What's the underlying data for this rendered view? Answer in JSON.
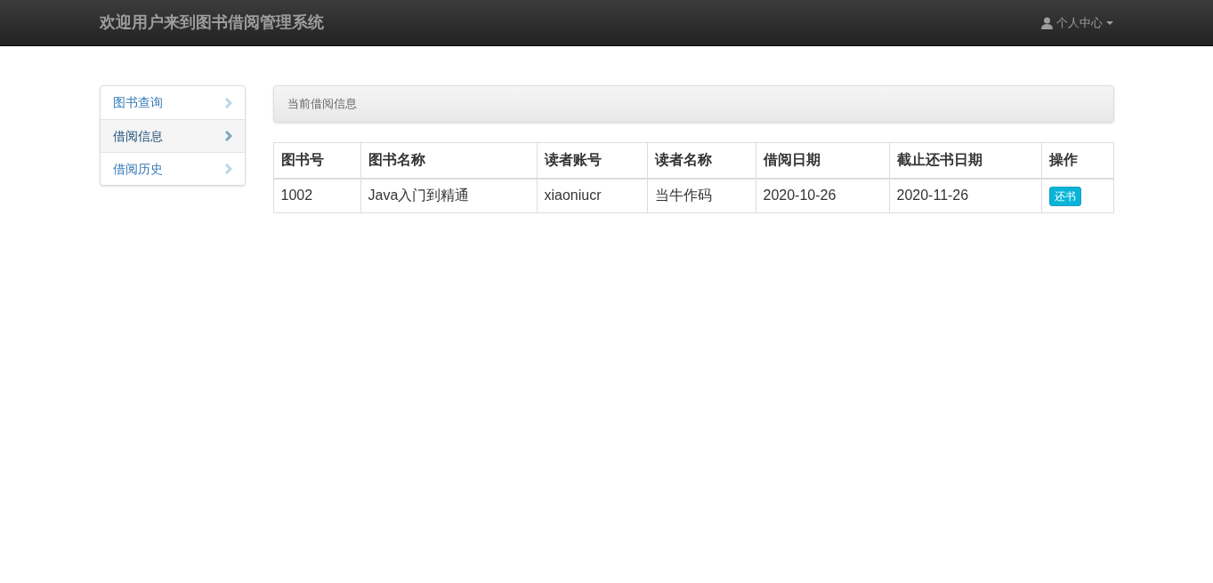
{
  "navbar": {
    "brand": "欢迎用户来到图书借阅管理系统",
    "user_menu": "个人中心"
  },
  "sidebar": {
    "items": [
      {
        "label": "图书查询",
        "selected": false
      },
      {
        "label": "借阅信息",
        "selected": true
      },
      {
        "label": "借阅历史",
        "selected": false
      }
    ]
  },
  "panel": {
    "title": "当前借阅信息"
  },
  "table": {
    "columns": [
      "图书号",
      "图书名称",
      "读者账号",
      "读者名称",
      "借阅日期",
      "截止还书日期",
      "操作"
    ],
    "rows": [
      {
        "cells": [
          "1002",
          "Java入门到精通",
          "xiaoniucr",
          "当牛作码",
          "2020-10-26",
          "2020-11-26"
        ],
        "action": "还书"
      }
    ]
  }
}
